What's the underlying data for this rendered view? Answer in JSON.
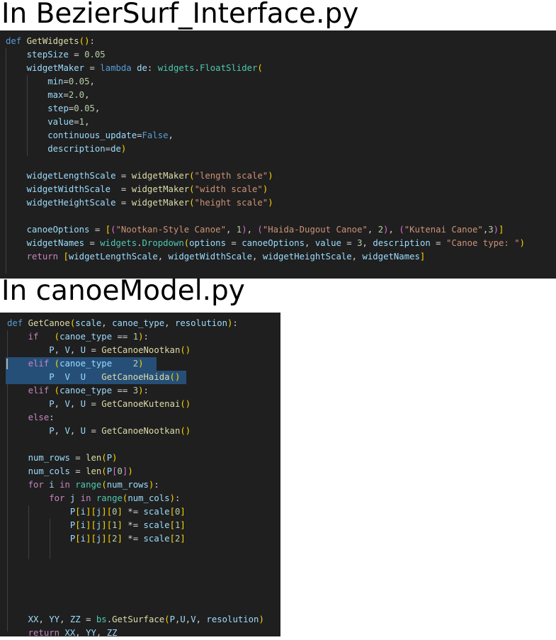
{
  "headings": {
    "interface": "In BezierSurf_Interface.py",
    "canoe_model": "In canoeModel.py"
  },
  "code_blocks": [
    {
      "file": "BezierSurf_Interface.py",
      "lines": [
        "def GetWidgets():",
        "    stepSize = 0.05",
        "    widgetMaker = lambda de: widgets.FloatSlider(",
        "        min=0.05,",
        "        max=2.0,",
        "        step=0.05,",
        "        value=1,",
        "        continuous_update=False,",
        "        description=de)",
        "",
        "    widgetLengthScale = widgetMaker(\"length scale\")",
        "    widgetWidthScale  = widgetMaker(\"width scale\")",
        "    widgetHeightScale = widgetMaker(\"height scale\")",
        "",
        "    canoeOptions = [(\"Nootkan-Style Canoe\", 1), (\"Haida-Dugout Canoe\", 2), (\"Kutenai Canoe\",3)]",
        "    widgetNames = widgets.Dropdown(options = canoeOptions, value = 3, description = \"Canoe type: \")",
        "    return [widgetLengthScale, widgetWidthScale, widgetHeightScale, widgetNames]"
      ]
    },
    {
      "file": "canoeModel.py",
      "selected_lines": [
        3,
        4
      ],
      "lines": [
        "def GetCanoe(scale, canoe_type, resolution):",
        "    if   (canoe_type == 1):",
        "        P, V, U = GetCanoeNootkan()",
        "    elif (canoe_type == 2):",
        "        P, V, U = GetCanoeHaida()",
        "    elif (canoe_type == 3):",
        "        P, V, U = GetCanoeKutenai()",
        "    else:",
        "        P, V, U = GetCanoeNootkan()",
        "",
        "    num_rows = len(P)",
        "    num_cols = len(P[0])",
        "    for i in range(num_rows):",
        "        for j in range(num_cols):",
        "            P[i][j][0] *= scale[0]",
        "            P[i][j][1] *= scale[1]",
        "            P[i][j][2] *= scale[2]",
        "",
        "",
        "",
        "",
        "",
        "    XX, YY, ZZ = bs.GetSurface(P,U,V, resolution)",
        "    return XX, YY, ZZ"
      ]
    }
  ]
}
